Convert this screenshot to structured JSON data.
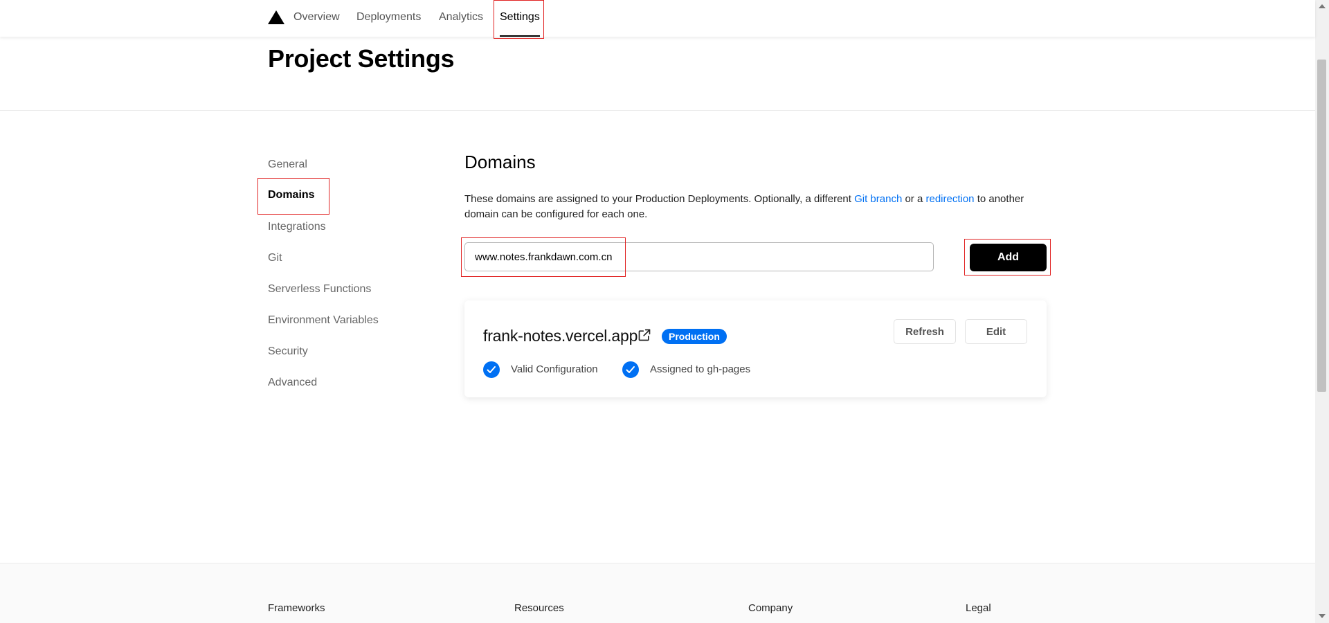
{
  "nav": {
    "tabs": [
      {
        "label": "Overview"
      },
      {
        "label": "Deployments"
      },
      {
        "label": "Analytics"
      },
      {
        "label": "Settings",
        "active": true
      }
    ]
  },
  "header": {
    "title": "Project Settings"
  },
  "sidebar": {
    "items": [
      {
        "label": "General"
      },
      {
        "label": "Domains",
        "active": true
      },
      {
        "label": "Integrations"
      },
      {
        "label": "Git"
      },
      {
        "label": "Serverless Functions"
      },
      {
        "label": "Environment Variables"
      },
      {
        "label": "Security"
      },
      {
        "label": "Advanced"
      }
    ]
  },
  "domains": {
    "title": "Domains",
    "description_part1": "These domains are assigned to your Production Deployments. Optionally, a different ",
    "link_git_branch": "Git branch",
    "description_part2": " or a ",
    "link_redirection": "redirection",
    "description_part3": " to another domain can be configured for each one.",
    "input_value": "www.notes.frankdawn.com.cn",
    "add_label": "Add",
    "card": {
      "domain": "frank-notes.vercel.app",
      "badge": "Production",
      "refresh_label": "Refresh",
      "edit_label": "Edit",
      "status_valid": "Valid Configuration",
      "status_assigned": "Assigned to gh-pages"
    }
  },
  "footer": {
    "columns": [
      "Frameworks",
      "Resources",
      "Company",
      "Legal"
    ]
  },
  "colors": {
    "accent": "#0070f3",
    "highlight": "#e02020",
    "primary_button": "#000000"
  },
  "icons": {
    "logo": "triangle-logo-icon",
    "external": "external-link-icon",
    "check": "check-circle-icon"
  }
}
